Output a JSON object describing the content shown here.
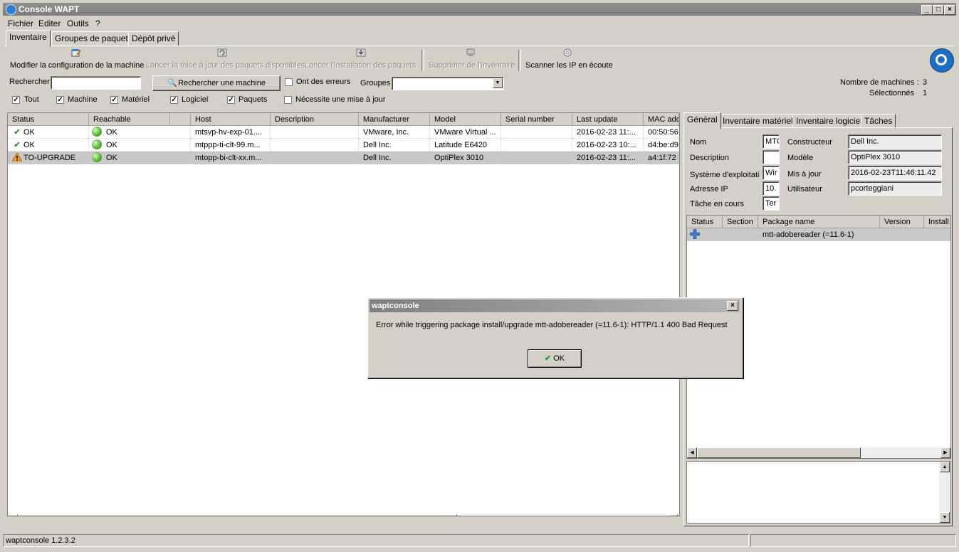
{
  "window": {
    "title": "Console WAPT"
  },
  "menu": [
    "Fichier",
    "Editer",
    "Outils",
    "?"
  ],
  "main_tabs": [
    "Inventaire",
    "Groupes de paquets",
    "Dépôt privé"
  ],
  "toolbar": {
    "modify": "Modifier la configuration de la machine",
    "update": "Lancer la mise à jour des paquets disponibles",
    "install": "Lancer l'installation des paquets",
    "delete": "Supprimer de l'inventaire",
    "scan": "Scanner les IP en écoute"
  },
  "search": {
    "label": "Rechercher",
    "value": "",
    "button": "Rechercher une machine",
    "errors_label": "Ont des erreurs",
    "groups_label": "Groupes",
    "groups_value": "",
    "needs_update_label": "Nécessite une mise à jour"
  },
  "filters": [
    {
      "label": "Tout",
      "checked": true
    },
    {
      "label": "Machine",
      "checked": true
    },
    {
      "label": "Matériel",
      "checked": true
    },
    {
      "label": "Logiciel",
      "checked": true
    },
    {
      "label": "Paquets",
      "checked": true
    }
  ],
  "stats": {
    "machines_label": "Nombre de machines :",
    "machines_value": "3",
    "selected_label": "Sélectionnés",
    "selected_value": "1"
  },
  "grid": {
    "columns": [
      "Status",
      "Reachable",
      "Host",
      "Description",
      "Manufacturer",
      "Model",
      "Serial number",
      "Last update",
      "MAC add"
    ],
    "rows": [
      {
        "status": "OK",
        "reachable": "OK",
        "host": "mtsvp-hv-exp-01....",
        "description": "",
        "manufacturer": "VMware, Inc.",
        "model": "VMware Virtual ...",
        "serial": "",
        "last_update": "2016-02-23 11:...",
        "mac": "00:50:56"
      },
      {
        "status": "OK",
        "reachable": "OK",
        "host": "mtppp-ti-clt-99.m...",
        "description": "",
        "manufacturer": "Dell Inc.",
        "model": "Latitude E6420",
        "serial": "",
        "last_update": "2016-02-23 10:...",
        "mac": "d4:be:d9"
      },
      {
        "status": "TO-UPGRADE",
        "reachable": "OK",
        "host": "mtopp-bi-clt-xx.m...",
        "description": "",
        "manufacturer": "Dell Inc.",
        "model": "OptiPlex 3010",
        "serial": "",
        "last_update": "2016-02-23 11:...",
        "mac": "a4:1f:72"
      }
    ]
  },
  "detail_tabs": [
    "Général",
    "Inventaire matériel",
    "Inventaire logiciel",
    "Tâches"
  ],
  "general": {
    "nom_label": "Nom",
    "nom_value": "MTC",
    "description_label": "Description",
    "description_value": "",
    "os_label": "Système d'exploitati",
    "os_value": "Wir",
    "ip_label": "Adresse IP",
    "ip_value": "10.",
    "task_label": "Tâche en cours",
    "task_value": "Ter",
    "manufacturer_label": "Constructeur",
    "manufacturer_value": "Dell Inc.",
    "model_label": "Modèle",
    "model_value": "OptiPlex 3010",
    "updated_label": "Mis à jour",
    "updated_value": "2016-02-23T11:46:11.42",
    "user_label": "Utilisateur",
    "user_value": "pcorteggiani"
  },
  "packages": {
    "columns": [
      "Status",
      "Section",
      "Package name",
      "Version",
      "Install"
    ],
    "rows": [
      {
        "status_icon": "plus-icon",
        "section": "",
        "name": "mtt-adobereader (=11.6-1)",
        "version": "",
        "install": ""
      }
    ]
  },
  "dialog": {
    "title": "waptconsole",
    "message": "Error while triggering package install/upgrade mtt-adobereader (=11.6-1): HTTP/1.1 400 Bad Request",
    "ok": "OK"
  },
  "statusbar": {
    "text": "waptconsole 1.2.3.2"
  },
  "colors": {
    "ok": "#2e9a2e",
    "warning": "#f0a020",
    "selected_row": "#c8c8c8"
  }
}
